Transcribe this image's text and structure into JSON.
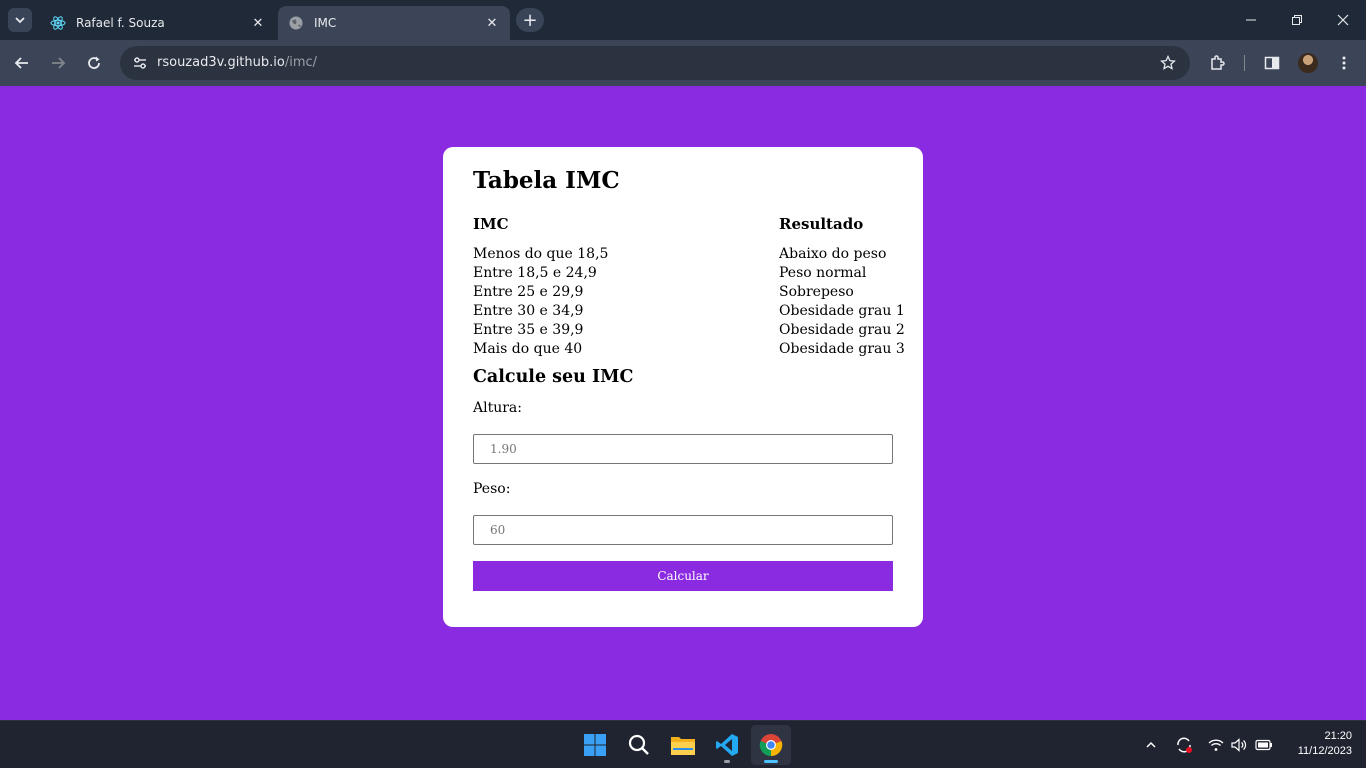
{
  "browser": {
    "tabs": [
      {
        "title": "Rafael f. Souza",
        "icon": "react-icon",
        "active": false
      },
      {
        "title": "IMC",
        "icon": "globe-icon",
        "active": true
      }
    ],
    "url_host": "rsouzad3v.github.io",
    "url_path": "/imc/"
  },
  "page": {
    "title": "Tabela IMC",
    "table": {
      "headers": [
        "IMC",
        "Resultado"
      ],
      "rows": [
        [
          "Menos do que 18,5",
          "Abaixo do peso"
        ],
        [
          "Entre 18,5 e 24,9",
          "Peso normal"
        ],
        [
          "Entre 25 e 29,9",
          "Sobrepeso"
        ],
        [
          "Entre 30 e 34,9",
          "Obesidade grau 1"
        ],
        [
          "Entre 35 e 39,9",
          "Obesidade grau 2"
        ],
        [
          "Mais do que 40",
          "Obesidade grau 3"
        ]
      ]
    },
    "calc_title": "Calcule seu IMC",
    "height_label": "Altura:",
    "height_placeholder": "1.90",
    "weight_label": "Peso:",
    "weight_placeholder": "60",
    "button_label": "Calcular"
  },
  "taskbar": {
    "apps": [
      "windows-start-icon",
      "search-icon",
      "file-explorer-icon",
      "vscode-icon",
      "chrome-icon"
    ],
    "time": "21:20",
    "date": "11/12/2023"
  },
  "colors": {
    "page_background": "#8a2be2",
    "button_background": "#8a2be2",
    "card_background": "#ffffff",
    "browser_frame": "#1f2937"
  }
}
